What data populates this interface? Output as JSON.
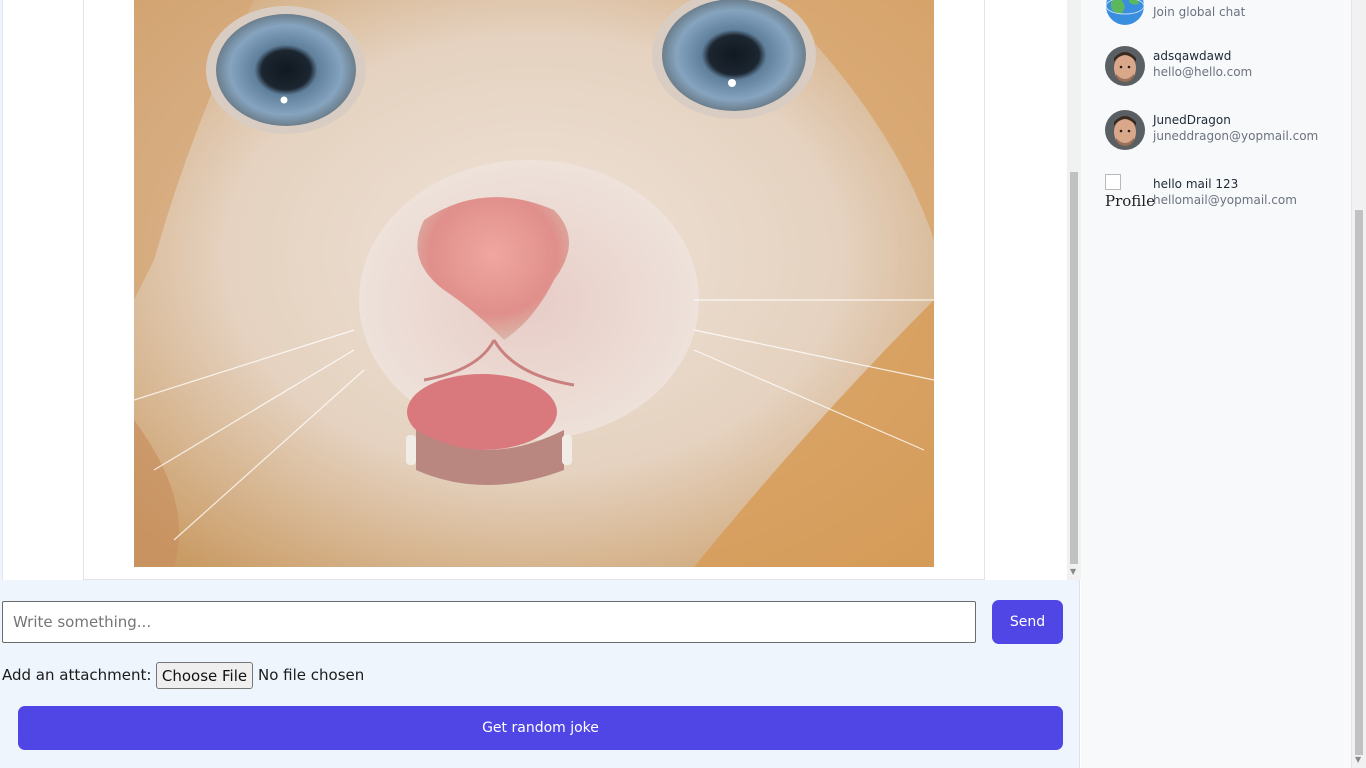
{
  "chat": {
    "input_placeholder": "Write something...",
    "send_label": "Send",
    "attachment_label": "Add an attachment:",
    "file_button_label": "Choose File",
    "file_status": "No file chosen",
    "joke_button_label": "Get random joke"
  },
  "sidebar": {
    "contacts": [
      {
        "name": "",
        "subtitle": "Join global chat",
        "avatar": "globe-icon"
      },
      {
        "name": "adsqawdawd",
        "subtitle": "hello@hello.com",
        "avatar": "profile-photo"
      },
      {
        "name": "JunedDragon",
        "subtitle": "juneddragon@yopmail.com",
        "avatar": "profile-photo"
      },
      {
        "name": "hello mail 123",
        "subtitle": "hellomail@yopmail.com",
        "avatar": "broken-image",
        "avatar_alt": "Profile"
      }
    ]
  },
  "colors": {
    "accent": "#4f46e5",
    "chat_background": "#eef5fd",
    "sidebar_background": "#f8f9fb"
  }
}
